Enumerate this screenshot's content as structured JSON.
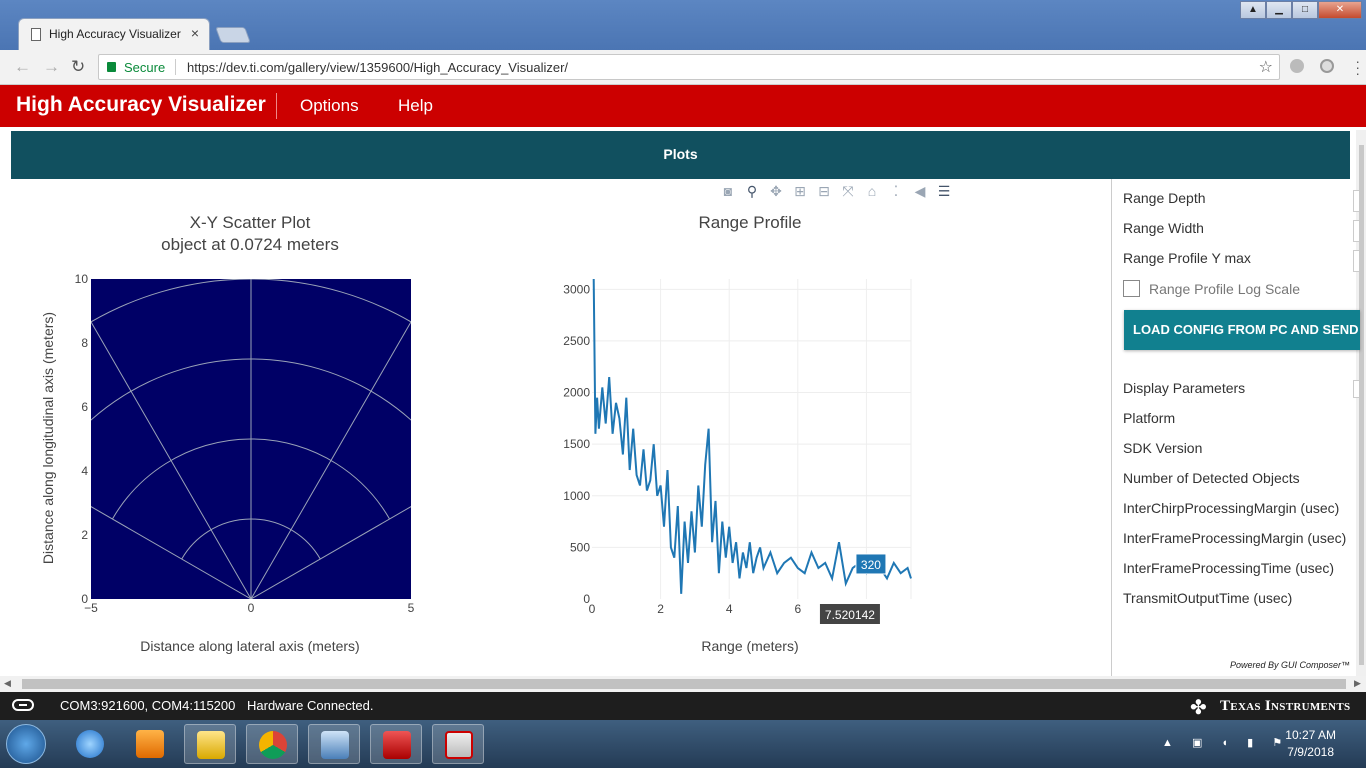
{
  "browser": {
    "tab_title": "High Accuracy Visualizer",
    "tab_close": "×",
    "secure_label": "Secure",
    "url": "https://dev.ti.com/gallery/view/1359600/High_Accuracy_Visualizer/",
    "star": "☆"
  },
  "app": {
    "title": "High Accuracy Visualizer",
    "menu": [
      "Options",
      "Help"
    ]
  },
  "plots_header": "Plots",
  "scatter": {
    "title_line1": "X-Y Scatter Plot",
    "title_line2": "object at 0.0724 meters",
    "xlabel": "Distance along lateral axis (meters)",
    "ylabel": "Distance along longitudinal axis (meters)",
    "xticks": [
      "−5",
      "0",
      "5"
    ],
    "yticks": [
      "0",
      "2",
      "4",
      "6",
      "8",
      "10"
    ],
    "bg_color": "#000066"
  },
  "chart_data": {
    "type": "line",
    "title": "Range Profile",
    "xlabel": "Range (meters)",
    "ylabel": "",
    "xlim": [
      0,
      9.3
    ],
    "ylim": [
      0,
      3100
    ],
    "xticks": [
      "0",
      "2",
      "4",
      "6",
      "8"
    ],
    "yticks": [
      "0",
      "500",
      "1000",
      "1500",
      "2000",
      "2500",
      "3000"
    ],
    "color": "#1f77b4",
    "x": [
      0.05,
      0.1,
      0.15,
      0.2,
      0.3,
      0.4,
      0.5,
      0.6,
      0.7,
      0.8,
      0.9,
      1.0,
      1.1,
      1.2,
      1.3,
      1.4,
      1.5,
      1.6,
      1.7,
      1.8,
      1.9,
      2.0,
      2.1,
      2.2,
      2.3,
      2.4,
      2.5,
      2.6,
      2.7,
      2.8,
      2.9,
      3.0,
      3.1,
      3.2,
      3.3,
      3.4,
      3.5,
      3.6,
      3.7,
      3.8,
      3.9,
      4.0,
      4.1,
      4.2,
      4.3,
      4.4,
      4.5,
      4.6,
      4.7,
      4.8,
      4.9,
      5.0,
      5.2,
      5.4,
      5.6,
      5.8,
      6.0,
      6.2,
      6.4,
      6.6,
      6.8,
      7.0,
      7.2,
      7.4,
      7.6,
      7.8,
      8.0,
      8.2,
      8.4,
      8.6,
      8.8,
      9.0,
      9.2,
      9.3
    ],
    "y": [
      3100,
      1600,
      1950,
      1650,
      2050,
      1700,
      2150,
      1600,
      1900,
      1750,
      1400,
      1950,
      1250,
      1650,
      1200,
      1100,
      1450,
      1050,
      1150,
      1500,
      1000,
      1100,
      700,
      1250,
      500,
      400,
      900,
      50,
      750,
      350,
      850,
      450,
      1100,
      700,
      1300,
      1650,
      550,
      950,
      250,
      750,
      400,
      700,
      350,
      550,
      200,
      450,
      300,
      550,
      250,
      400,
      500,
      300,
      450,
      250,
      350,
      400,
      300,
      250,
      450,
      300,
      350,
      200,
      550,
      150,
      300,
      350,
      250,
      400,
      300,
      200,
      350,
      250,
      300,
      200
    ],
    "hover_y_label": "320",
    "hover_x_label": "7.520142"
  },
  "modebar_icons": [
    "camera-icon",
    "zoom-icon",
    "pan-icon",
    "zoom-in-icon",
    "zoom-out-icon",
    "autoscale-icon",
    "home-icon",
    "spike-icon",
    "hover-closest-icon",
    "hover-compare-icon"
  ],
  "side": {
    "params": [
      "Range Depth",
      "Range Width",
      "Range Profile Y max"
    ],
    "log_scale_label": "Range Profile Log Scale",
    "load_button": "LOAD CONFIG FROM PC AND SEND",
    "display_params": [
      "Display Parameters",
      "Platform",
      "SDK Version",
      "Number of Detected Objects",
      "InterChirpProcessingMargin (usec)",
      "InterFrameProcessingMargin (usec)",
      "InterFrameProcessingTime (usec)",
      "TransmitOutputTime (usec)"
    ],
    "powered_by": "Powered By GUI Composer™"
  },
  "status": {
    "ports": "COM3:921600, COM4:115200",
    "hardware": "Hardware Connected.",
    "brand": "Texas Instruments"
  },
  "taskbar": {
    "time": "10:27 AM",
    "date": "7/9/2018"
  }
}
